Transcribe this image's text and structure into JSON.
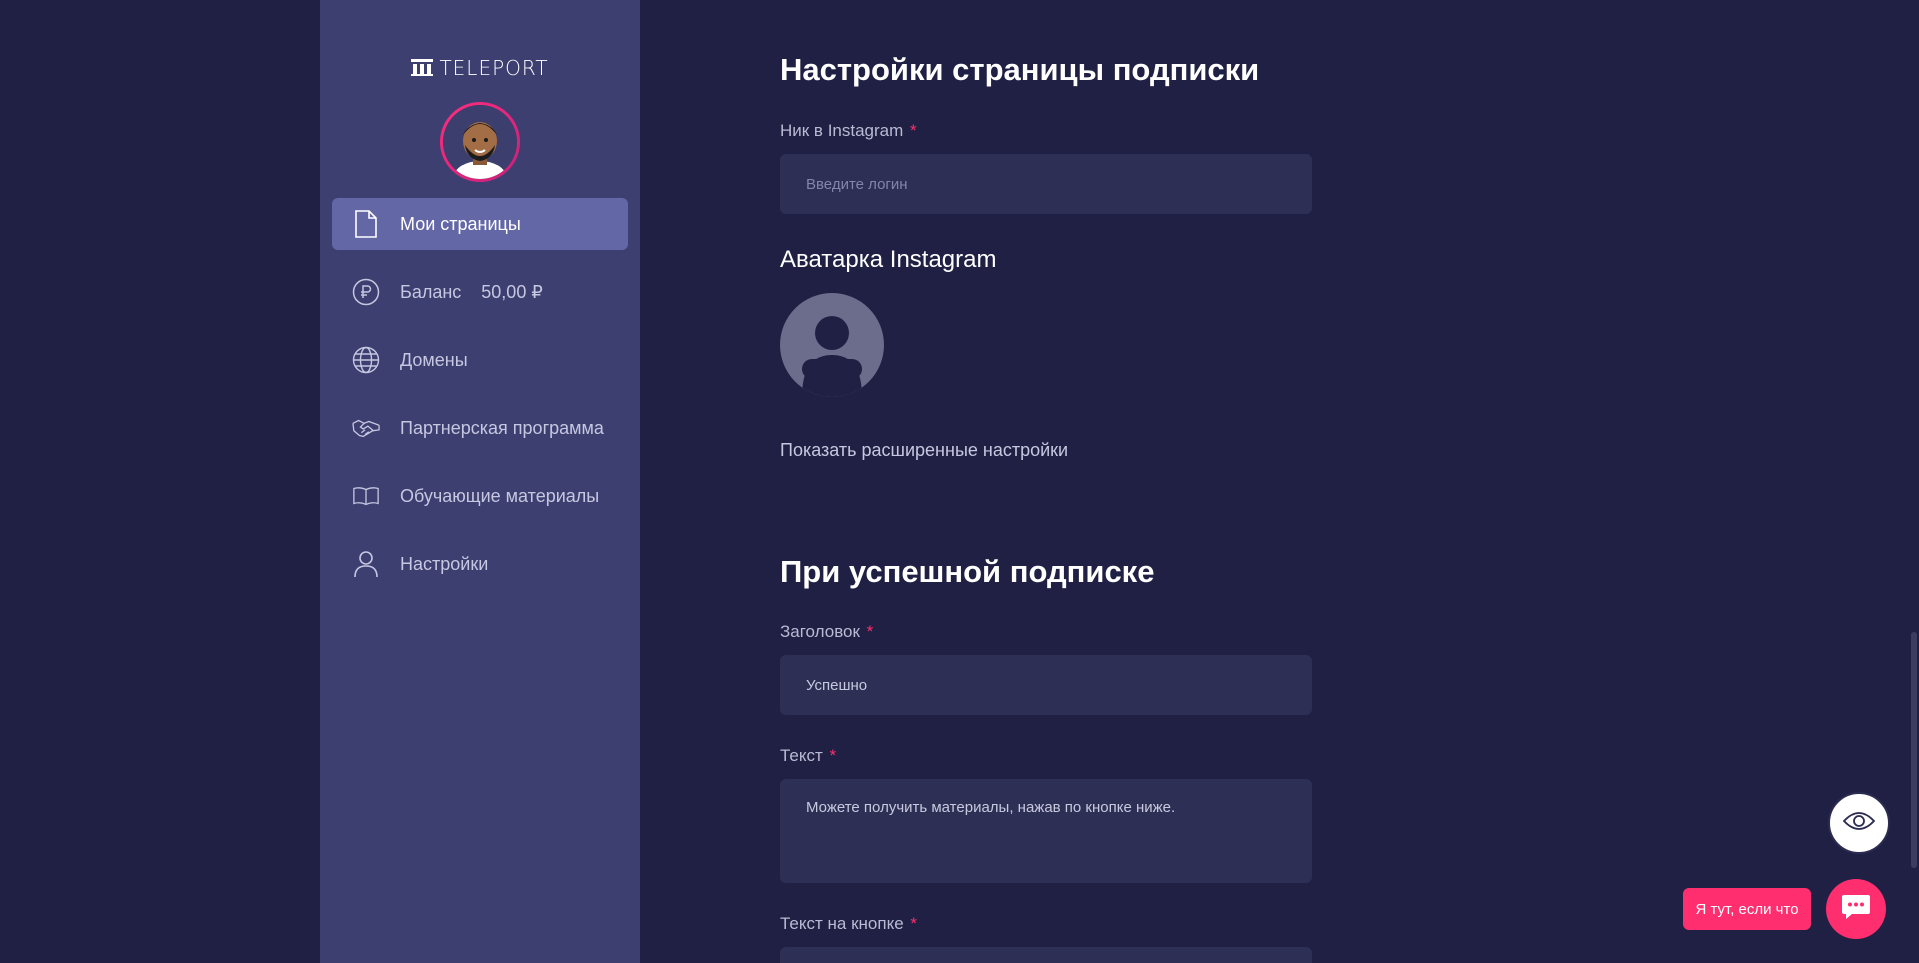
{
  "sidebar": {
    "logo_text": "TELEPORT",
    "nav": [
      {
        "label": "Мои страницы",
        "icon": "document-icon",
        "active": true
      },
      {
        "label": "Баланс",
        "icon": "ruble-coin-icon",
        "value": "50,00 ₽"
      },
      {
        "label": "Домены",
        "icon": "globe-icon"
      },
      {
        "label": "Партнерская программа",
        "icon": "handshake-icon"
      },
      {
        "label": "Обучающие материалы",
        "icon": "book-icon"
      },
      {
        "label": "Настройки",
        "icon": "user-icon"
      }
    ]
  },
  "main": {
    "section1": {
      "title": "Настройки страницы подписки",
      "instagram_label": "Ник в Instagram",
      "instagram_required": "*",
      "instagram_placeholder": "Введите логин",
      "avatar_title": "Аватарка Instagram",
      "advanced_link": "Показать расширенные настройки"
    },
    "section2": {
      "title": "При успешной подписке",
      "heading_label": "Заголовок",
      "heading_required": "*",
      "heading_value": "Успешно",
      "text_label": "Текст",
      "text_required": "*",
      "text_value": "Можете получить материалы, нажав по кнопке ниже.",
      "button_text_label": "Текст на кнопке",
      "button_text_required": "*"
    }
  },
  "widgets": {
    "preview_icon": "eye-icon",
    "chat_label": "Я тут, если что",
    "chat_icon": "chat-bubble-icon"
  },
  "colors": {
    "background": "#1f2043",
    "sidebar": "#3d3f70",
    "active_item": "#6467a6",
    "accent": "#ff2e6e",
    "input_bg": "#2e2f55"
  }
}
